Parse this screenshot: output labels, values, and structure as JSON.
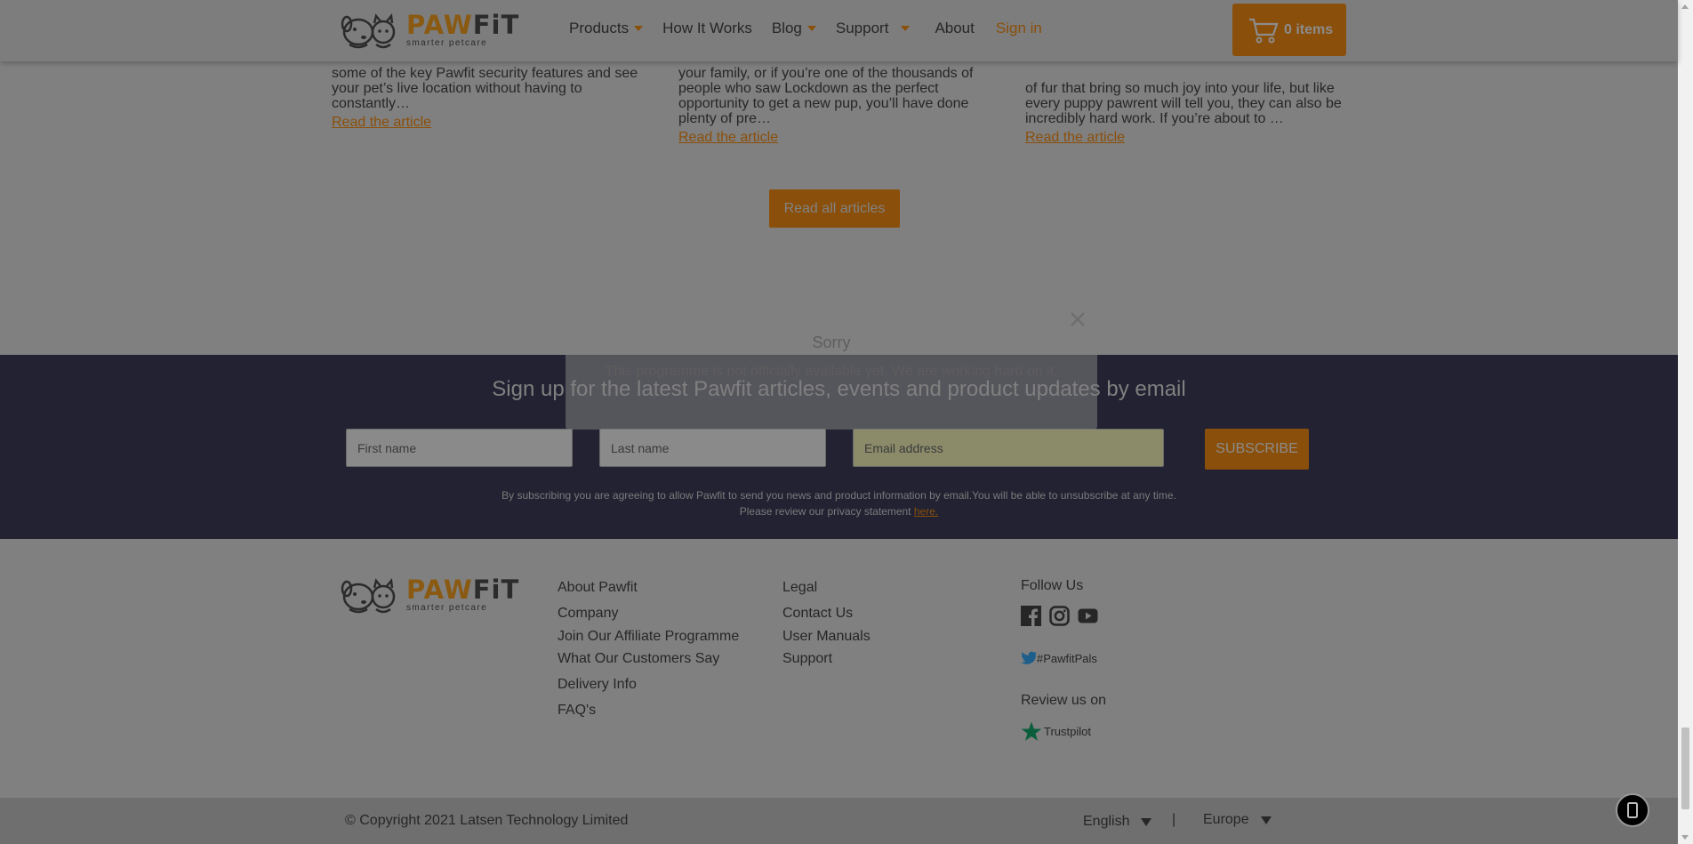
{
  "brand": {
    "name_part1": "PAW",
    "name_part2": "FiT",
    "tagline": "smarter petcare"
  },
  "nav": {
    "products": "Products",
    "how_it_works": "How It Works",
    "blog": "Blog",
    "support": "Support",
    "about": "About",
    "sign_in": "Sign in"
  },
  "cart": {
    "count": "0",
    "label": "items",
    "icon": "shopping-cart-icon"
  },
  "articles": [
    {
      "excerpt": "some of the key Pawfit security features and see your pet’s live location without having to constantly…",
      "link": "Read the article"
    },
    {
      "excerpt": "your family, or if you’re one of the thousands of people who saw Lockdown as the perfect opportunity to get a new pup, you’ll have done plenty of pre…",
      "link": "Read the article"
    },
    {
      "excerpt": "of fur that bring so much joy into your life, but like every puppy pawrent will tell you, they can also be incredibly hard work. If you’re about to …",
      "link": "Read the article"
    }
  ],
  "read_all": "Read all articles",
  "newsletter": {
    "title": "Sign up for the latest Pawfit articles, events and product updates by email",
    "first_name_placeholder": "First name",
    "last_name_placeholder": "Last name",
    "email_placeholder": "Email address",
    "subscribe": "SUBSCRIBE",
    "fine_print_line1": "By subscribing you are agreeing to allow Pawfit to send you news and product information by email.You will be able to unsubscribe at any time.",
    "fine_print_line2": "Please review our privacy statement",
    "fine_print_link": "here."
  },
  "modal": {
    "title": "Sorry",
    "message": "This programme is not officially available yet. We are working hard on it."
  },
  "footer": {
    "col1": [
      "About Pawfit",
      "Company",
      "Join Our Affiliate Programme",
      "What Our Customers Say",
      "Delivery Info",
      "FAQ's"
    ],
    "col2": [
      "Legal",
      "Contact Us",
      "User Manuals",
      "Support"
    ],
    "follow_us": "Follow Us",
    "social_icons": [
      "facebook-icon",
      "instagram-icon",
      "youtube-icon"
    ],
    "twitter_tag": "#PawfitPals",
    "review_us": "Review us on",
    "trustpilot": "Trustpilot"
  },
  "bottom": {
    "copyright": "© Copyright 2021 Latsen Technology Limited",
    "language": "English",
    "separator": "|",
    "region": "Europe"
  },
  "colors": {
    "accent": "#8a4f0a",
    "newsletter_bg": "#222232",
    "page_overlay": "#808080"
  }
}
